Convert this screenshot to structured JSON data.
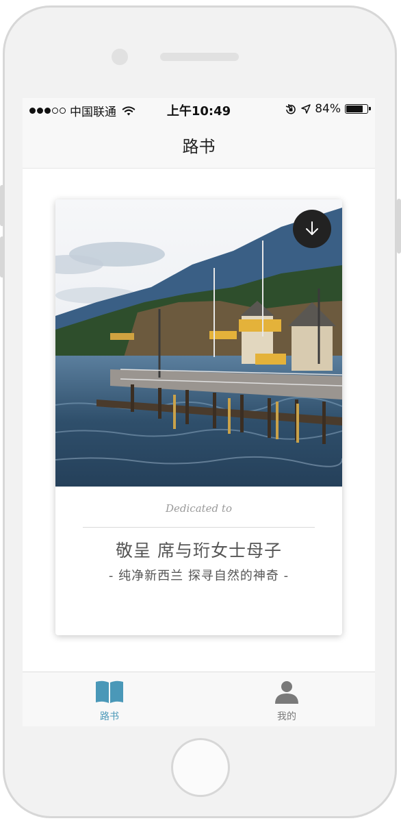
{
  "statusbar": {
    "carrier": "中国联通",
    "time": "上午10:49",
    "battery_percent": "84%",
    "battery_level": 0.84,
    "signal_bars_filled": 3,
    "signal_bars_total": 5
  },
  "navbar": {
    "title": "路书"
  },
  "card": {
    "image_icon": "download-icon",
    "dedicated_label": "Dedicated to",
    "dedicatee": "敬呈 席与珩女士母子",
    "subtitle": "- 纯净新西兰 探寻自然的神奇 -"
  },
  "tabbar": {
    "tabs": [
      {
        "label": "路书",
        "icon": "book-icon",
        "active": true
      },
      {
        "label": "我的",
        "icon": "person-icon",
        "active": false
      }
    ]
  },
  "colors": {
    "accent": "#4a98b8",
    "inactive": "#7a7a7a",
    "text_dark": "#555555",
    "text_muted": "#9a9a9a"
  }
}
